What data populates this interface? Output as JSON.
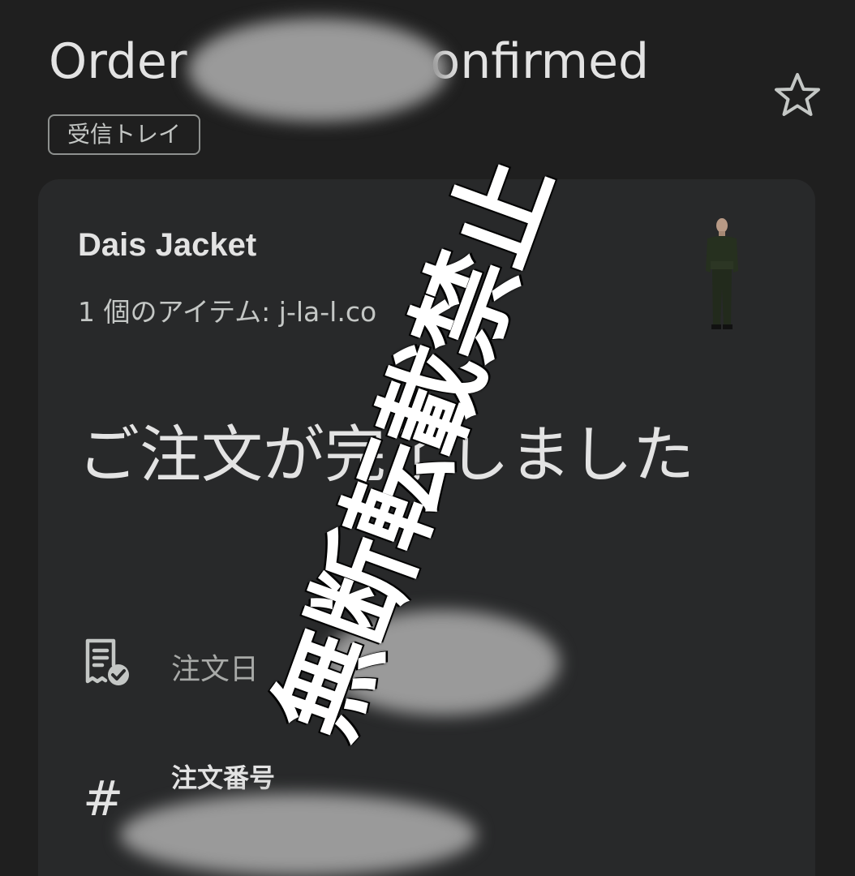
{
  "header": {
    "title_left": "Order",
    "title_right": "onfirmed",
    "label": "受信トレイ",
    "star_icon": "star-outline-icon"
  },
  "order_card": {
    "product_name": "Dais Jacket",
    "item_summary": "1 個のアイテム: j-la-l.co",
    "headline": "ご注文が完了しました",
    "order_date_label": "注文日",
    "order_number_label": "注文番号",
    "receipt_icon": "receipt-check-icon",
    "hash_icon": "hash-icon",
    "hash_glyph": "#"
  },
  "watermark": {
    "text": "無断転載禁止"
  },
  "colors": {
    "background": "#1f1f1f",
    "card": "#28292a",
    "text_primary": "#e3e3e3",
    "text_secondary": "#c4c7c5"
  }
}
